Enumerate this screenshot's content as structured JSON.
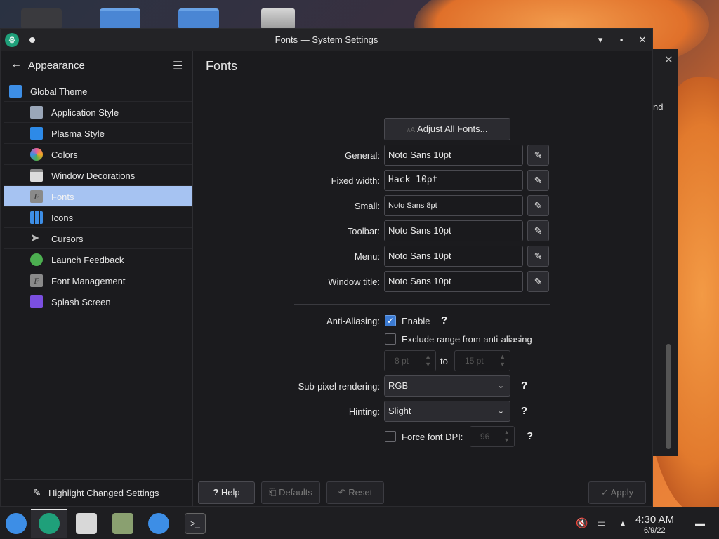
{
  "window": {
    "title": "Fonts — System Settings",
    "minimize": "▾",
    "maximize": "▪",
    "close": "✕"
  },
  "sidebar": {
    "back_icon": "←",
    "title": "Appearance",
    "menu_icon": "☰",
    "items": [
      {
        "label": "Global Theme",
        "icon": "global-theme-icon",
        "color": "#3d8ee6"
      },
      {
        "label": "Application Style",
        "icon": "application-style-icon",
        "color": "#9aa6b8"
      },
      {
        "label": "Plasma Style",
        "icon": "plasma-style-icon",
        "color": "#2d8ae8"
      },
      {
        "label": "Colors",
        "icon": "colors-icon",
        "color": "#e85d9a"
      },
      {
        "label": "Window Decorations",
        "icon": "window-decorations-icon",
        "color": "#dcdcdc"
      },
      {
        "label": "Fonts",
        "icon": "fonts-icon",
        "color": "#8a8a8a"
      },
      {
        "label": "Icons",
        "icon": "icons-icon",
        "color": "#3d8ee6"
      },
      {
        "label": "Cursors",
        "icon": "cursors-icon",
        "color": "#bbbbbb"
      },
      {
        "label": "Launch Feedback",
        "icon": "launch-feedback-icon",
        "color": "#4caf50"
      },
      {
        "label": "Font Management",
        "icon": "font-management-icon",
        "color": "#8a8a8a"
      },
      {
        "label": "Splash Screen",
        "icon": "splash-screen-icon",
        "color": "#7b4fe0"
      }
    ],
    "selected_color": "#a6c3f2",
    "footer_label": "Highlight Changed Settings"
  },
  "content": {
    "title": "Fonts",
    "adjust_all_label": "Adjust All Fonts...",
    "fonts": [
      {
        "label": "General:",
        "value": "Noto Sans 10pt"
      },
      {
        "label": "Fixed width:",
        "value": "Hack 10pt"
      },
      {
        "label": "Small:",
        "value": "Noto Sans 8pt"
      },
      {
        "label": "Toolbar:",
        "value": "Noto Sans 10pt"
      },
      {
        "label": "Menu:",
        "value": "Noto Sans 10pt"
      },
      {
        "label": "Window title:",
        "value": "Noto Sans 10pt"
      }
    ],
    "antialiasing_label": "Anti-Aliasing:",
    "enable_label": "Enable",
    "exclude_label": "Exclude range from anti-aliasing",
    "range_from": "8 pt",
    "range_to_label": "to",
    "range_to": "15 pt",
    "subpixel_label": "Sub-pixel rendering:",
    "subpixel_value": "RGB",
    "hinting_label": "Hinting:",
    "hinting_value": "Slight",
    "force_dpi_label": "Force font DPI:",
    "force_dpi_value": "96",
    "help_mark": "?"
  },
  "footer": {
    "help_label": "Help",
    "defaults_label": "Defaults",
    "reset_label": "Reset",
    "apply_label": "Apply"
  },
  "taskbar": {
    "time": "4:30 AM",
    "date": "6/9/22"
  },
  "desktop": {
    "back_window_text": "nd"
  }
}
